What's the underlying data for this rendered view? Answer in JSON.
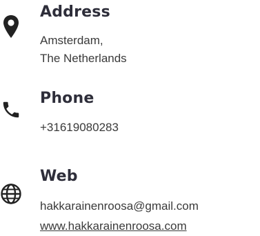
{
  "address": {
    "icon": "map-pin-icon",
    "title": "Address",
    "lines": [
      "Amsterdam,",
      "The Netherlands"
    ]
  },
  "phone": {
    "icon": "phone-icon",
    "title": "Phone",
    "number": "+31619080283"
  },
  "web": {
    "icon": "globe-icon",
    "title": "Web",
    "email": "hakkarainenroosa@gmail.com",
    "website": "www.hakkarainenroosa.com"
  },
  "colors": {
    "text_heading": "#2e2e3a",
    "text_body": "#3a3a3a",
    "icon": "#222222",
    "background": "#ffffff"
  }
}
